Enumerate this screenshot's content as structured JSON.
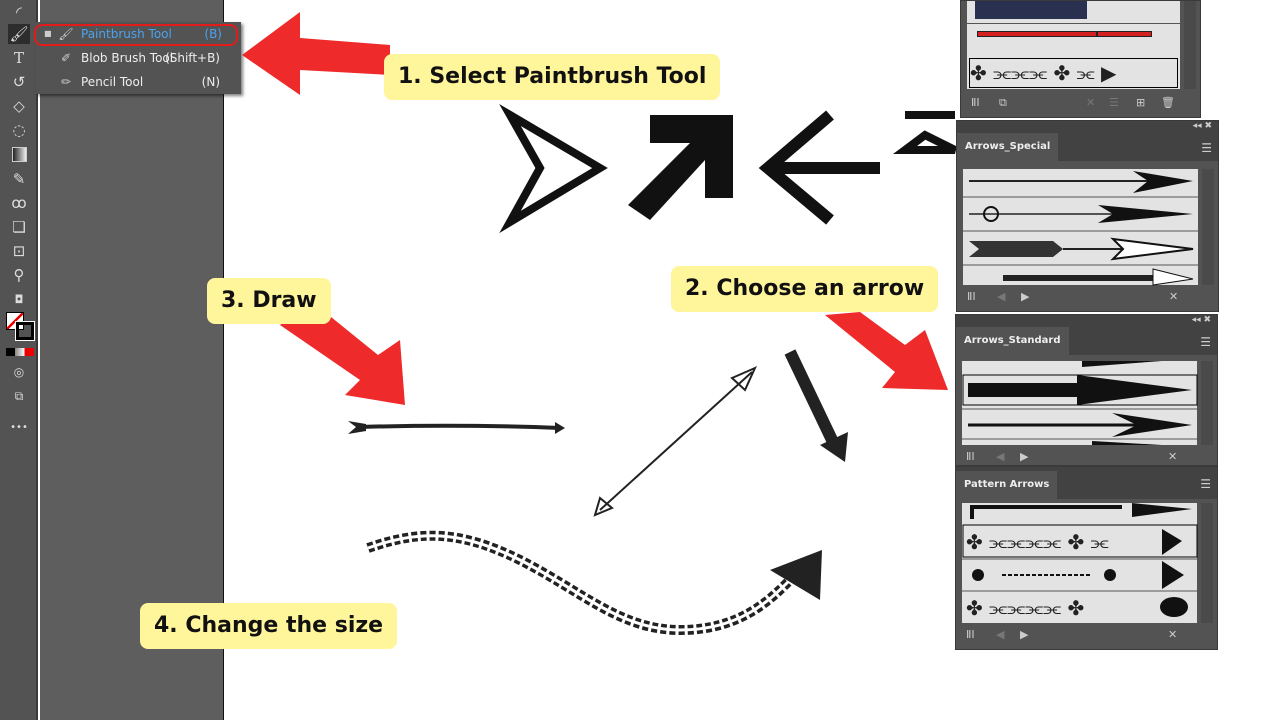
{
  "toolbar": {
    "tools": [
      "curvature-tool",
      "paintbrush-tool",
      "type-tool",
      "rotate-tool",
      "eraser-tool",
      "lasso-tool",
      "gradient-tool",
      "eyedropper-tool",
      "blend-tool",
      "shape-builder-tool",
      "artboard-tool",
      "zoom-tool",
      "swap-fill-stroke",
      "fill-stroke",
      "color-modes",
      "draw-mode",
      "screen-mode",
      "more-tools"
    ],
    "more": "•••"
  },
  "flyout": {
    "items": [
      {
        "label": "Paintbrush Tool",
        "shortcut": "(B)",
        "selected": true
      },
      {
        "label": "Blob Brush Tool",
        "shortcut": "(Shift+B)"
      },
      {
        "label": "Pencil Tool",
        "shortcut": "(N)"
      }
    ]
  },
  "callouts": {
    "step1": "1. Select Paintbrush Tool",
    "step2": "2. Choose an arrow",
    "step3": "3. Draw",
    "step4": "4. Change the size"
  },
  "panels": {
    "special": {
      "title": "Arrows_Special"
    },
    "standard": {
      "title": "Arrows_Standard"
    },
    "pattern": {
      "title": "Pattern Arrows"
    }
  },
  "colors": {
    "callout": "#fff59b",
    "red_arrow": "#ee2a2a",
    "selection": "#e21b1b",
    "highlight_text": "#4aa3f0"
  }
}
